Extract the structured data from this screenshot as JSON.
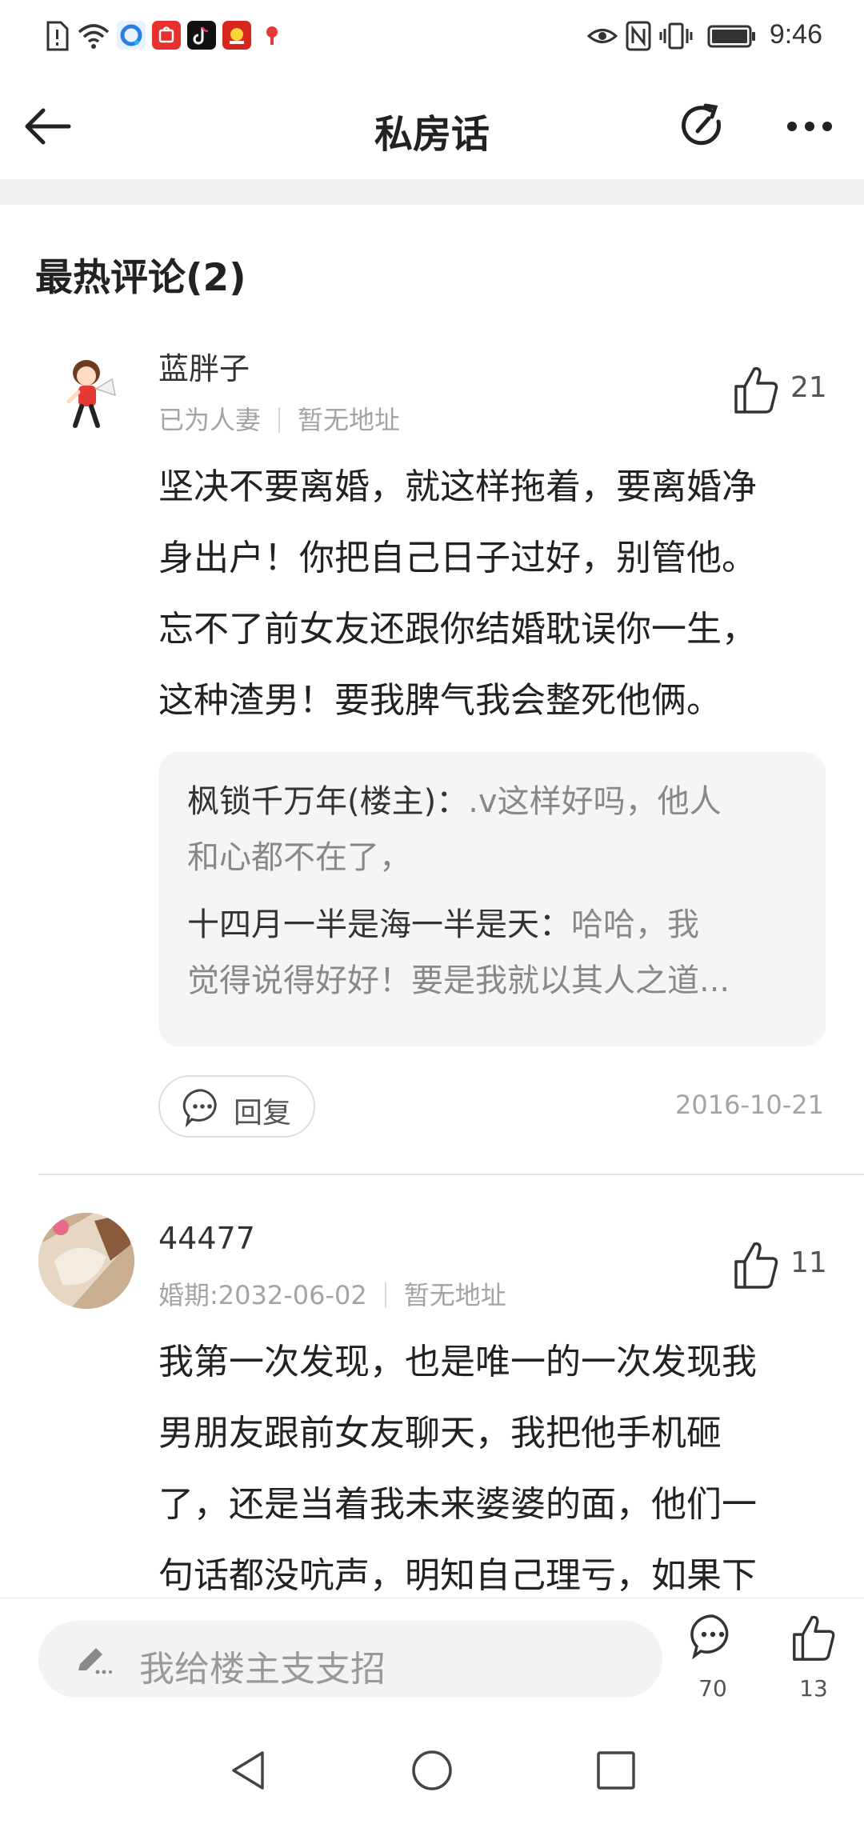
{
  "status_bar": {
    "time": "9:46",
    "icons": [
      "alert-icon",
      "wifi-icon",
      "browser-app-icon",
      "huawei-mall-app-icon",
      "tiktok-app-icon",
      "game-app-icon",
      "map-app-icon",
      "eye-comfort-icon",
      "nfc-icon",
      "vibrate-icon",
      "battery-icon"
    ]
  },
  "app_bar": {
    "title": "私房话",
    "back_icon": "back-arrow-icon",
    "refresh_icon": "refresh-icon",
    "more_icon": "more-dots-icon"
  },
  "section": {
    "heading": "最热评论(2)"
  },
  "comments": [
    {
      "username": "蓝胖子",
      "status": "已为人妻",
      "location": "暂无地址",
      "likes": "21",
      "lines": [
        "坚决不要离婚，就这样拖着，要离婚净",
        "身出户！你把自己日子过好，别管他。",
        "忘不了前女友还跟你结婚耽误你一生，",
        "这种渣男！要我脾气我会整死他俩。"
      ],
      "replies": [
        {
          "author": "枫锁千万年(楼主)：",
          "line1": ".v这样好吗，他人",
          "line2": "和心都不在了，"
        },
        {
          "author": "十四月一半是海一半是天：",
          "line1": "哈哈，我",
          "line2": "觉得说得好好！要是我就以其人之道..."
        }
      ],
      "reply_label": "回复",
      "date": "2016-10-21"
    },
    {
      "username": "44477",
      "status": "婚期:2032-06-02",
      "location": "暂无地址",
      "likes": "11",
      "lines": [
        "我第一次发现，也是唯一的一次发现我",
        "男朋友跟前女友聊天，我把他手机砸",
        "了，还是当着我未来婆婆的面，他们一",
        "句话都没吭声，明知自己理亏，如果下"
      ]
    }
  ],
  "bottom_bar": {
    "input_placeholder": "我给楼主支支招",
    "comment_count": "70",
    "like_count": "13"
  },
  "colors": {
    "background": "#ffffff",
    "band": "#f1f1f3",
    "reply_box": "#f5f5f7",
    "muted_text": "#a4a4a4"
  }
}
